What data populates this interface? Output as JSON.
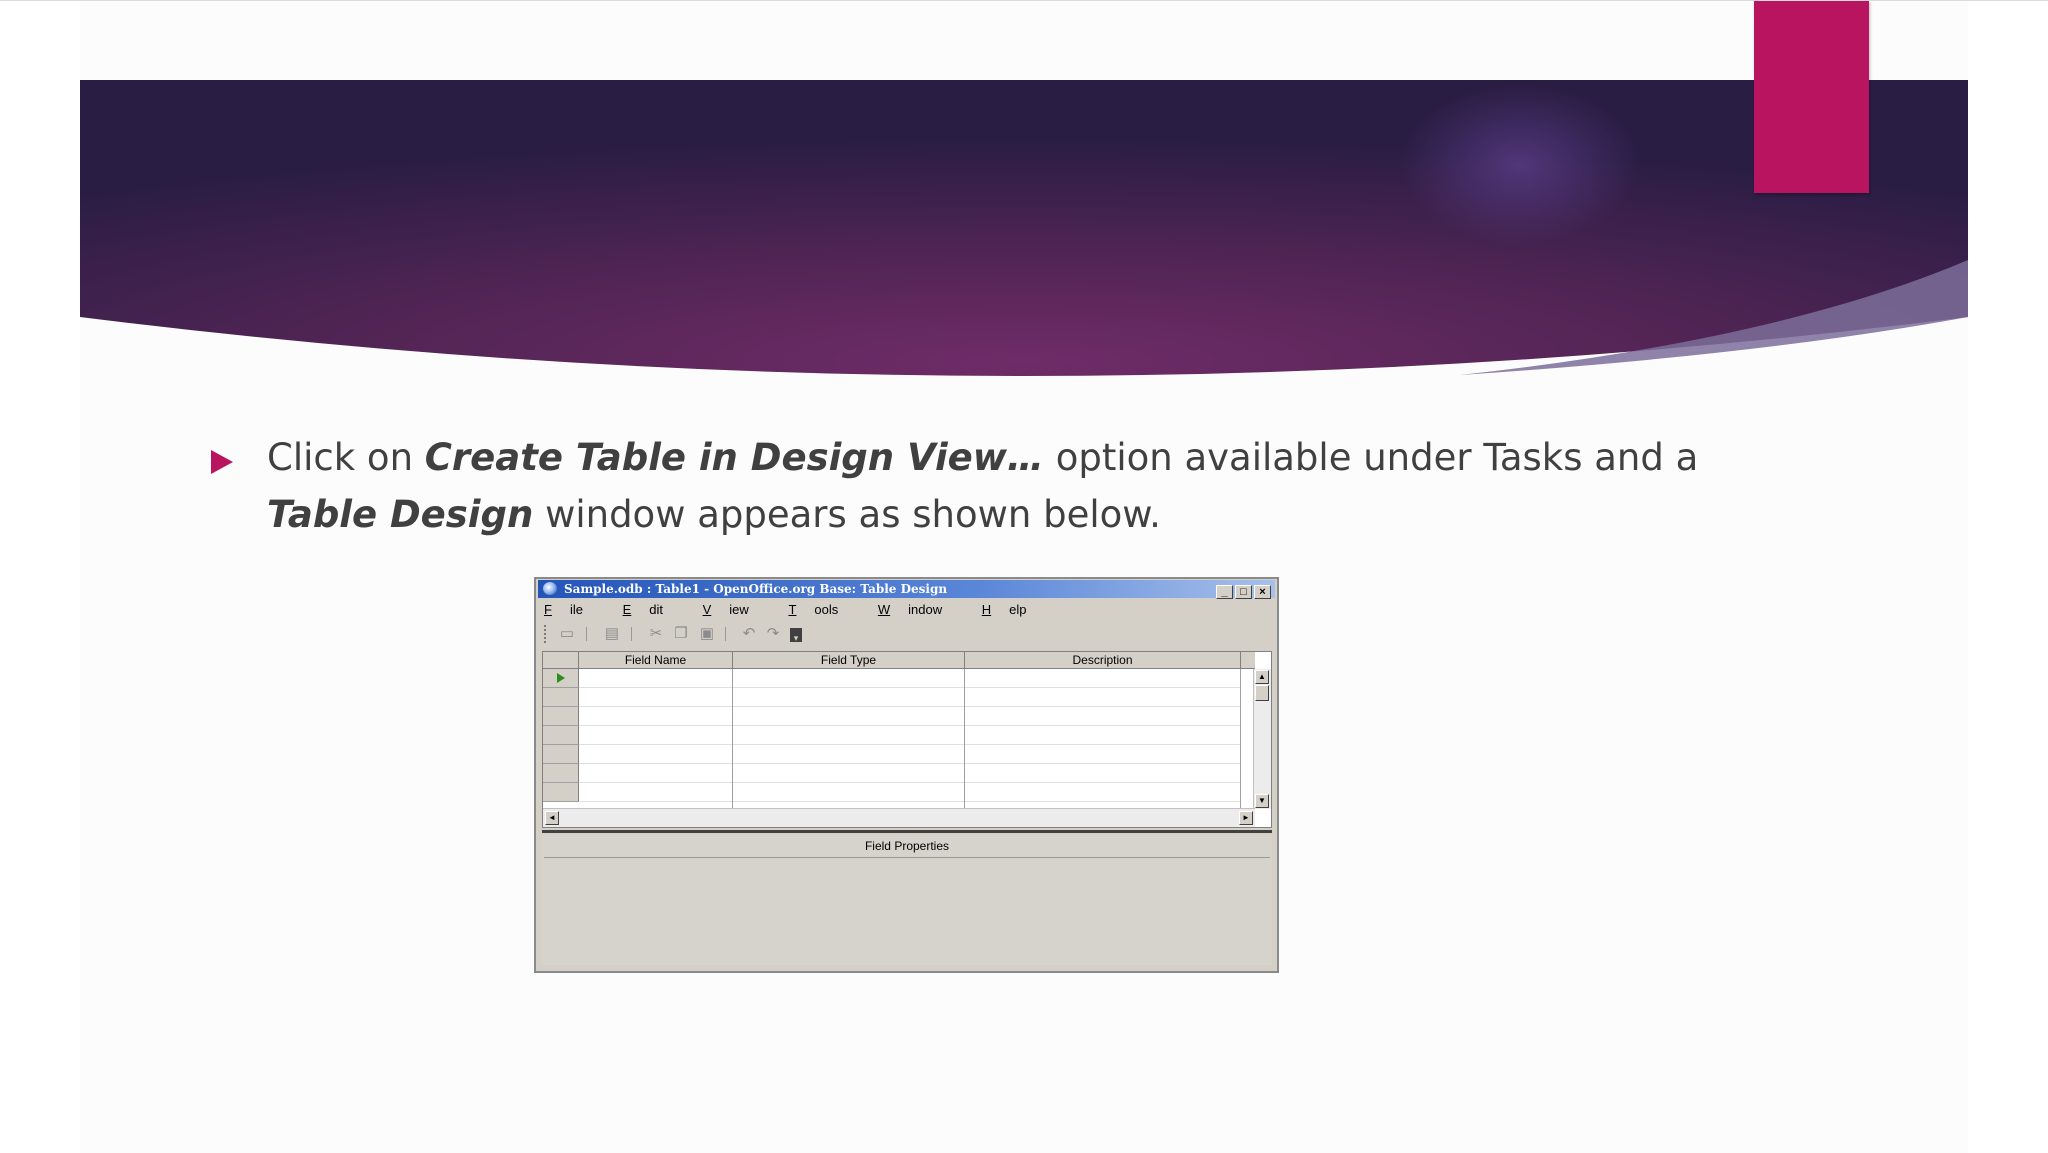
{
  "colors": {
    "accent": "#b8145f",
    "banner_dark": "#2a1d44",
    "banner_mid": "#6a2c68",
    "text": "#404040"
  },
  "slide": {
    "bullet": {
      "part1": "Click on ",
      "emph1": "Create Table in Design View…",
      "part2": " option available under Tasks and a ",
      "emph2": "Table Design",
      "part3": " window appears as shown below."
    }
  },
  "window": {
    "title": "Sample.odb : Table1 - OpenOffice.org Base: Table Design",
    "controls": {
      "minimize": "_",
      "maximize": "□",
      "close": "×"
    },
    "menu": {
      "file": {
        "u": "F",
        "rest": "ile"
      },
      "edit": {
        "u": "E",
        "rest": "dit"
      },
      "view": {
        "u": "V",
        "rest": "iew"
      },
      "tools": {
        "u": "T",
        "rest": "ools"
      },
      "window": {
        "u": "W",
        "rest": "indow"
      },
      "help": {
        "u": "H",
        "rest": "elp"
      }
    },
    "toolbar_icons": [
      "save-icon",
      "edit-icon",
      "cut-icon",
      "copy-icon",
      "paste-icon",
      "undo-icon",
      "redo-icon",
      "dropdown-icon"
    ],
    "grid": {
      "columns": [
        "Field Name",
        "Field Type",
        "Description"
      ]
    },
    "field_properties_label": "Field Properties"
  }
}
